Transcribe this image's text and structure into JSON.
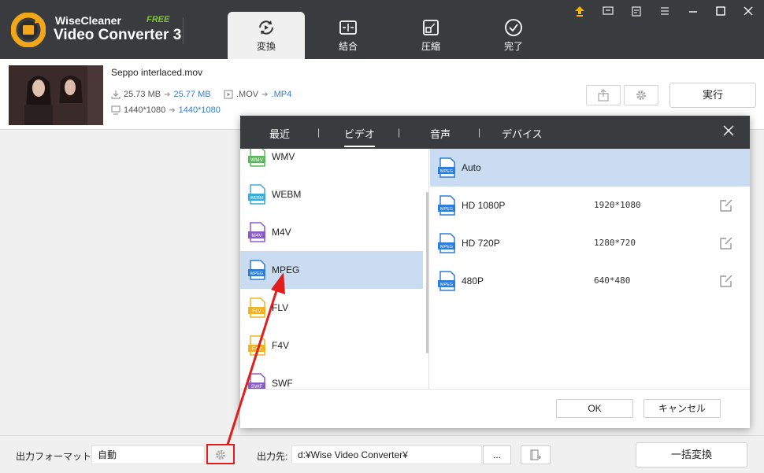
{
  "app": {
    "brand_line1": "WiseCleaner",
    "brand_badge": "FREE",
    "brand_line2": "Video Converter 3"
  },
  "tabs": [
    {
      "label": "変換",
      "icon": "convert-icon"
    },
    {
      "label": "結合",
      "icon": "merge-icon"
    },
    {
      "label": "圧縮",
      "icon": "compress-icon"
    },
    {
      "label": "完了",
      "icon": "done-icon"
    }
  ],
  "file": {
    "name": "Seppo interlaced.mov",
    "size_from": "25.73 MB",
    "size_to": "25.77 MB",
    "format_from": ".MOV",
    "format_to": ".MP4",
    "res_from": "1440*1080",
    "res_to": "1440*1080",
    "run_label": "実行"
  },
  "dialog": {
    "tabs": [
      "最近",
      "ビデオ",
      "音声",
      "デバイス"
    ],
    "active_tab": "ビデオ",
    "formats": [
      {
        "name": "WMV",
        "color": "#5cb85c"
      },
      {
        "name": "WEBM",
        "color": "#3aaed8"
      },
      {
        "name": "M4V",
        "color": "#8a5cc8"
      },
      {
        "name": "MPEG",
        "color": "#2e7dd7"
      },
      {
        "name": "FLV",
        "color": "#f0b323"
      },
      {
        "name": "F4V",
        "color": "#f0b323"
      },
      {
        "name": "SWF",
        "color": "#8a5cc8"
      }
    ],
    "selected_format": "MPEG",
    "presets": [
      {
        "name": "Auto",
        "res": ""
      },
      {
        "name": "HD 1080P",
        "res": "1920*1080"
      },
      {
        "name": "HD 720P",
        "res": "1280*720"
      },
      {
        "name": "480P",
        "res": "640*480"
      }
    ],
    "preset_icon_label": "MPEG",
    "ok_label": "OK",
    "cancel_label": "キャンセル"
  },
  "bottom": {
    "format_label": "出力フォーマット:",
    "format_value": "自動",
    "dest_label": "出力先:",
    "dest_value": "d:¥Wise Video Converter¥",
    "browse_label": "...",
    "convert_all_label": "一括変換"
  },
  "colors": {
    "header_bg": "#3a3b3e",
    "selection": "#c9dcf2",
    "accent_blue": "#3a7bc8",
    "highlight_red": "#e01e1e",
    "update_icon": "#f5b400"
  }
}
